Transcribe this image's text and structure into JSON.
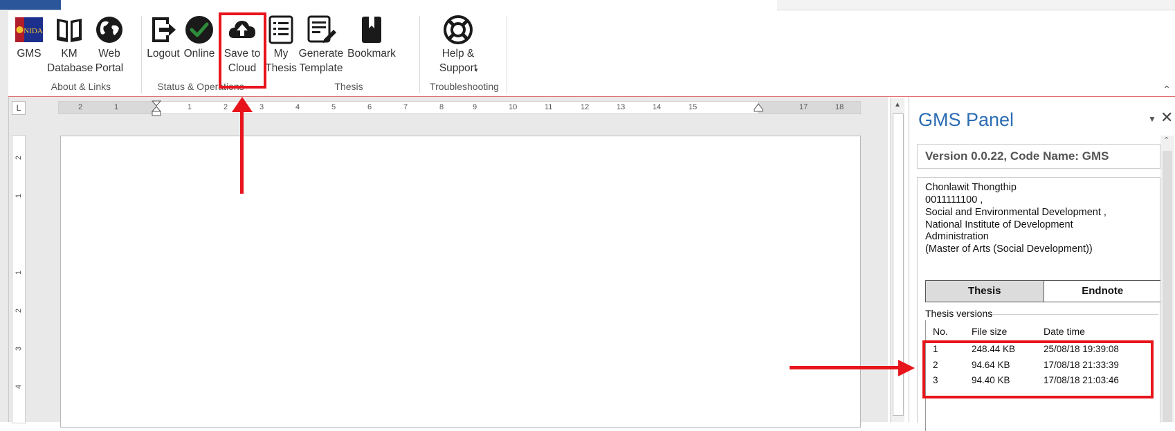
{
  "ribbon": {
    "buttons": [
      {
        "key": "gms",
        "label": "GMS"
      },
      {
        "key": "km",
        "label": "KM\nDatabase"
      },
      {
        "key": "web",
        "label": "Web\nPortal"
      },
      {
        "key": "logout",
        "label": "Logout"
      },
      {
        "key": "online",
        "label": "Online"
      },
      {
        "key": "save",
        "label": "Save to\nCloud"
      },
      {
        "key": "mythesis",
        "label": "My\nThesis"
      },
      {
        "key": "generate",
        "label": "Generate\nTemplate"
      },
      {
        "key": "bookmark",
        "label": "Bookmark"
      },
      {
        "key": "help",
        "label": "Help &\nSupport"
      }
    ],
    "groups": {
      "about": "About & Links",
      "status": "Status & Operations",
      "thesis": "Thesis",
      "trouble": "Troubleshooting"
    },
    "logo_text": "NIDA"
  },
  "ruler": {
    "corner": "L",
    "h_ticks": [
      "2",
      "1",
      "1",
      "2",
      "3",
      "4",
      "5",
      "6",
      "7",
      "8",
      "9",
      "10",
      "11",
      "12",
      "13",
      "14",
      "15",
      "17",
      "18"
    ],
    "v_ticks": [
      "2",
      "1",
      "1",
      "2",
      "3",
      "4"
    ]
  },
  "panel": {
    "title": "GMS Panel",
    "version": "Version 0.0.22, Code Name: GMS",
    "user": {
      "name": "Chonlawit Thongthip",
      "id": "0011111100  ,",
      "faculty": "Social and Environmental Development ,",
      "institute_1": "National Institute of Development",
      "institute_2": "Administration",
      "degree": "(Master of Arts (Social Development))"
    },
    "tabs": [
      "Thesis",
      "Endnote"
    ],
    "versions_label": "Thesis versions",
    "columns": [
      "No.",
      "File size",
      "Date time"
    ],
    "rows": [
      {
        "no": "1",
        "size": "248.44 KB",
        "date": "25/08/18 19:39:08"
      },
      {
        "no": "2",
        "size": "94.64 KB",
        "date": "17/08/18 21:33:39"
      },
      {
        "no": "3",
        "size": "94.40 KB",
        "date": "17/08/18 21:03:46"
      }
    ]
  },
  "colors": {
    "accent_blue": "#2b6cb3",
    "highlight_red": "#e8141b",
    "online_green": "#2e8b3a"
  }
}
